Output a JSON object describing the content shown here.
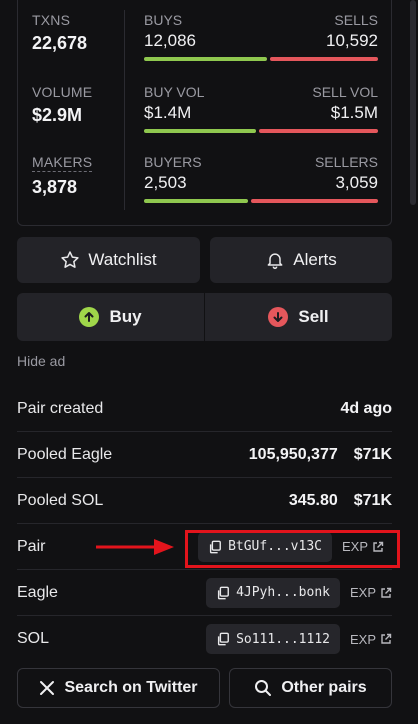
{
  "stats": {
    "txns_label": "TXNS",
    "txns_value": "22,678",
    "volume_label": "VOLUME",
    "volume_value": "$2.9M",
    "makers_label": "MAKERS",
    "makers_value": "3,878",
    "buys_label": "BUYS",
    "buys_value": "12,086",
    "sells_label": "SELLS",
    "sells_value": "10,592",
    "buy_vol_label": "BUY VOL",
    "buy_vol_value": "$1.4M",
    "sell_vol_label": "SELL VOL",
    "sell_vol_value": "$1.5M",
    "buyers_label": "BUYERS",
    "buyers_value": "2,503",
    "sellers_label": "SELLERS",
    "sellers_value": "3,059"
  },
  "bars": {
    "txns_buy_fraction": 0.533,
    "volume_buy_fraction": 0.483,
    "makers_buy_fraction": 0.45
  },
  "actions": {
    "watchlist_label": "Watchlist",
    "alerts_label": "Alerts",
    "buy_label": "Buy",
    "sell_label": "Sell",
    "hide_ad_label": "Hide ad"
  },
  "info": {
    "pair_created_label": "Pair created",
    "pair_created_value": "4d ago",
    "pooled_eagle_label": "Pooled Eagle",
    "pooled_eagle_amount": "105,950,377",
    "pooled_eagle_usd": "$71K",
    "pooled_sol_label": "Pooled SOL",
    "pooled_sol_amount": "345.80",
    "pooled_sol_usd": "$71K",
    "pair_label": "Pair",
    "pair_address": "BtGUf...v13C",
    "eagle_label": "Eagle",
    "eagle_address": "4JPyh...bonk",
    "sol_label": "SOL",
    "sol_address": "So111...1112",
    "exp_label": "EXP"
  },
  "links": {
    "twitter_label": "Search on Twitter",
    "other_pairs_label": "Other pairs"
  },
  "colors": {
    "buy": "#8fc84f",
    "sell": "#e5575c",
    "highlight": "#e3141c"
  },
  "icons": [
    "star-icon",
    "bell-icon",
    "arrow-up-circle-icon",
    "arrow-down-circle-icon",
    "copy-icon",
    "external-link-icon",
    "x-logo-icon",
    "search-icon",
    "red-arrow-icon"
  ]
}
